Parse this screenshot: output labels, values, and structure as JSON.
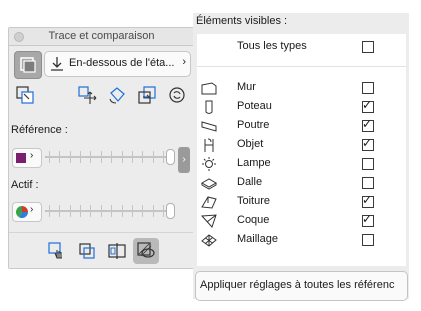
{
  "left_panel": {
    "title": "Trace et comparaison",
    "placement_label": "En-dessous de l'éta...",
    "reference_label": "Référence :",
    "active_label": "Actif :",
    "reference_color": "#7a1f6e",
    "reference_level": 1.0,
    "active_level": 1.0
  },
  "right_panel": {
    "header": "Éléments visibles :",
    "all_types": {
      "label": "Tous les types",
      "checked": false
    },
    "items": [
      {
        "label": "Mur",
        "icon": "wall-icon",
        "checked": false
      },
      {
        "label": "Poteau",
        "icon": "column-icon",
        "checked": true
      },
      {
        "label": "Poutre",
        "icon": "beam-icon",
        "checked": true
      },
      {
        "label": "Objet",
        "icon": "object-icon",
        "checked": true
      },
      {
        "label": "Lampe",
        "icon": "lamp-icon",
        "checked": false
      },
      {
        "label": "Dalle",
        "icon": "slab-icon",
        "checked": false
      },
      {
        "label": "Toiture",
        "icon": "roof-icon",
        "checked": true
      },
      {
        "label": "Coque",
        "icon": "shell-icon",
        "checked": true
      },
      {
        "label": "Maillage",
        "icon": "mesh-icon",
        "checked": false
      }
    ],
    "apply_button": "Appliquer réglages à toutes les référenc"
  }
}
